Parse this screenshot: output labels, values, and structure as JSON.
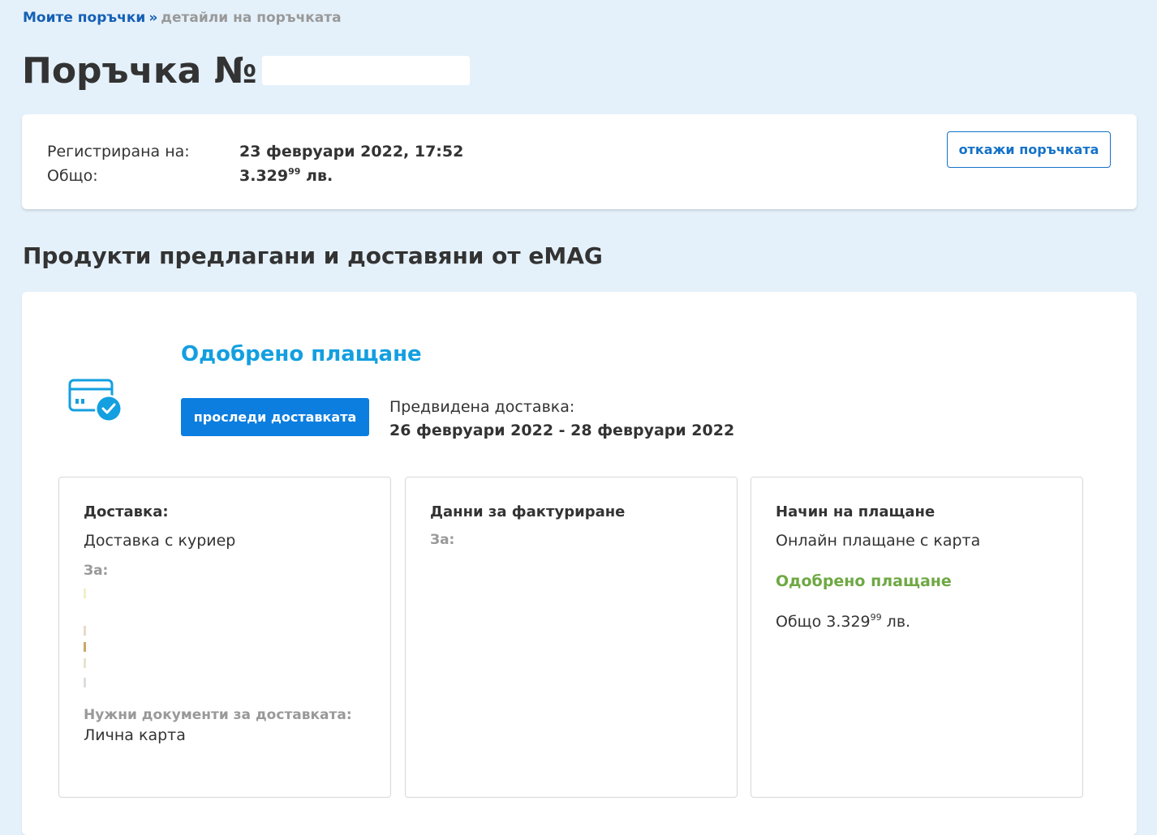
{
  "breadcrumb": {
    "parent": "Моите поръчки",
    "separator": "»",
    "current": "детайли на поръчката"
  },
  "order": {
    "title": "Поръчка №",
    "registered_label": "Регистрирана на:",
    "registered_value": "23 февруари 2022, 17:52",
    "total_label": "Общо:",
    "total_main": "3.329",
    "total_cents": "99",
    "total_currency": " лв.",
    "cancel_label": "откажи поръчката"
  },
  "section": {
    "title": "Продукти предлагани и доставяни от eMAG"
  },
  "status": {
    "icon": "card-check-icon",
    "title": "Одобрено плащане",
    "track_label": "проследи доставката",
    "eta_label": "Предвидена доставка:",
    "eta_dates": "26 февруари 2022 - 28 февруари 2022"
  },
  "delivery": {
    "title": "Доставка:",
    "method": "Доставка с куриер",
    "for_label": "За:",
    "docs_label": "Нужни документи за доставката:",
    "docs_value": "Лична карта"
  },
  "billing": {
    "title": "Данни за фактуриране",
    "for_label": "За:"
  },
  "payment": {
    "title": "Начин на плащане",
    "method": "Онлайн плащане с карта",
    "status": "Одобрено плащане",
    "total_prefix": "Общо ",
    "total_main": "3.329",
    "total_cents": "99",
    "total_currency": " лв."
  },
  "colors": {
    "background": "#e5f1fa",
    "link": "#1560b5",
    "accent_blue": "#139fe0",
    "button_blue": "#0c7ee0",
    "approved_green": "#6ea843"
  }
}
